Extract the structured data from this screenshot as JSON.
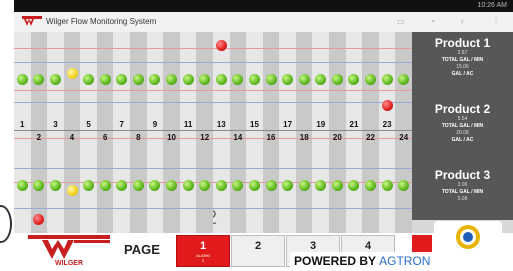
{
  "status": {
    "time": "10:26 AM"
  },
  "app": {
    "title": "Wilger Flow Monitoring System"
  },
  "toolbar": {
    "icons": [
      "monitor-icon",
      "wifi-icon",
      "bulb-icon",
      "overflow-menu-icon"
    ]
  },
  "grid": {
    "top_numbers": [
      "1",
      "3",
      "5",
      "7",
      "9",
      "11",
      "13",
      "15",
      "17",
      "19",
      "21",
      "23"
    ],
    "bottom_numbers": [
      "2",
      "4",
      "6",
      "8",
      "10",
      "12",
      "14",
      "16",
      "18",
      "20",
      "22",
      "24"
    ],
    "row1": [
      "green",
      "green",
      "green",
      "green",
      "green",
      "green",
      "green",
      "green",
      "green",
      "green",
      "green",
      "green",
      "red",
      "green",
      "green",
      "green",
      "green",
      "green",
      "green",
      "green",
      "green",
      "green",
      "red",
      "green"
    ],
    "row2": [
      "green",
      "red",
      "green",
      "green",
      "green",
      "green",
      "green",
      "green",
      "green",
      "green",
      "green",
      "green",
      "green",
      "green",
      "green",
      "green",
      "green",
      "green",
      "green",
      "green",
      "green",
      "green",
      "green",
      "green"
    ],
    "page_number": "2",
    "cursor_glyph": "I"
  },
  "products": [
    {
      "title": "Product 1",
      "rate": "2.87",
      "rate_unit": "TOTAL GAL / MIN",
      "app_rate": "15.06",
      "app_unit": "GAL / AC"
    },
    {
      "title": "Product 2",
      "rate": "5.54",
      "rate_unit": "TOTAL GAL / MIN",
      "app_rate": "20.08",
      "app_unit": "GAL / AC"
    },
    {
      "title": "Product 3",
      "rate": "3.06",
      "rate_unit": "TOTAL GAL / MIN",
      "app_rate": "5.08",
      "app_unit": ""
    }
  ],
  "bottom": {
    "brand": "WILGER",
    "page_label": "PAGE",
    "pages": [
      "1",
      "2",
      "3",
      "4"
    ],
    "alarm_label": "ALARM",
    "alarm_count": "3",
    "powered_text": "POWERED BY",
    "powered_brand": "AGTRON"
  },
  "colors": {
    "panel": "#575757",
    "active_page": "#e11b1b",
    "grid_line_red": "#e79a9a",
    "grid_line_blue": "#9aaad6"
  }
}
